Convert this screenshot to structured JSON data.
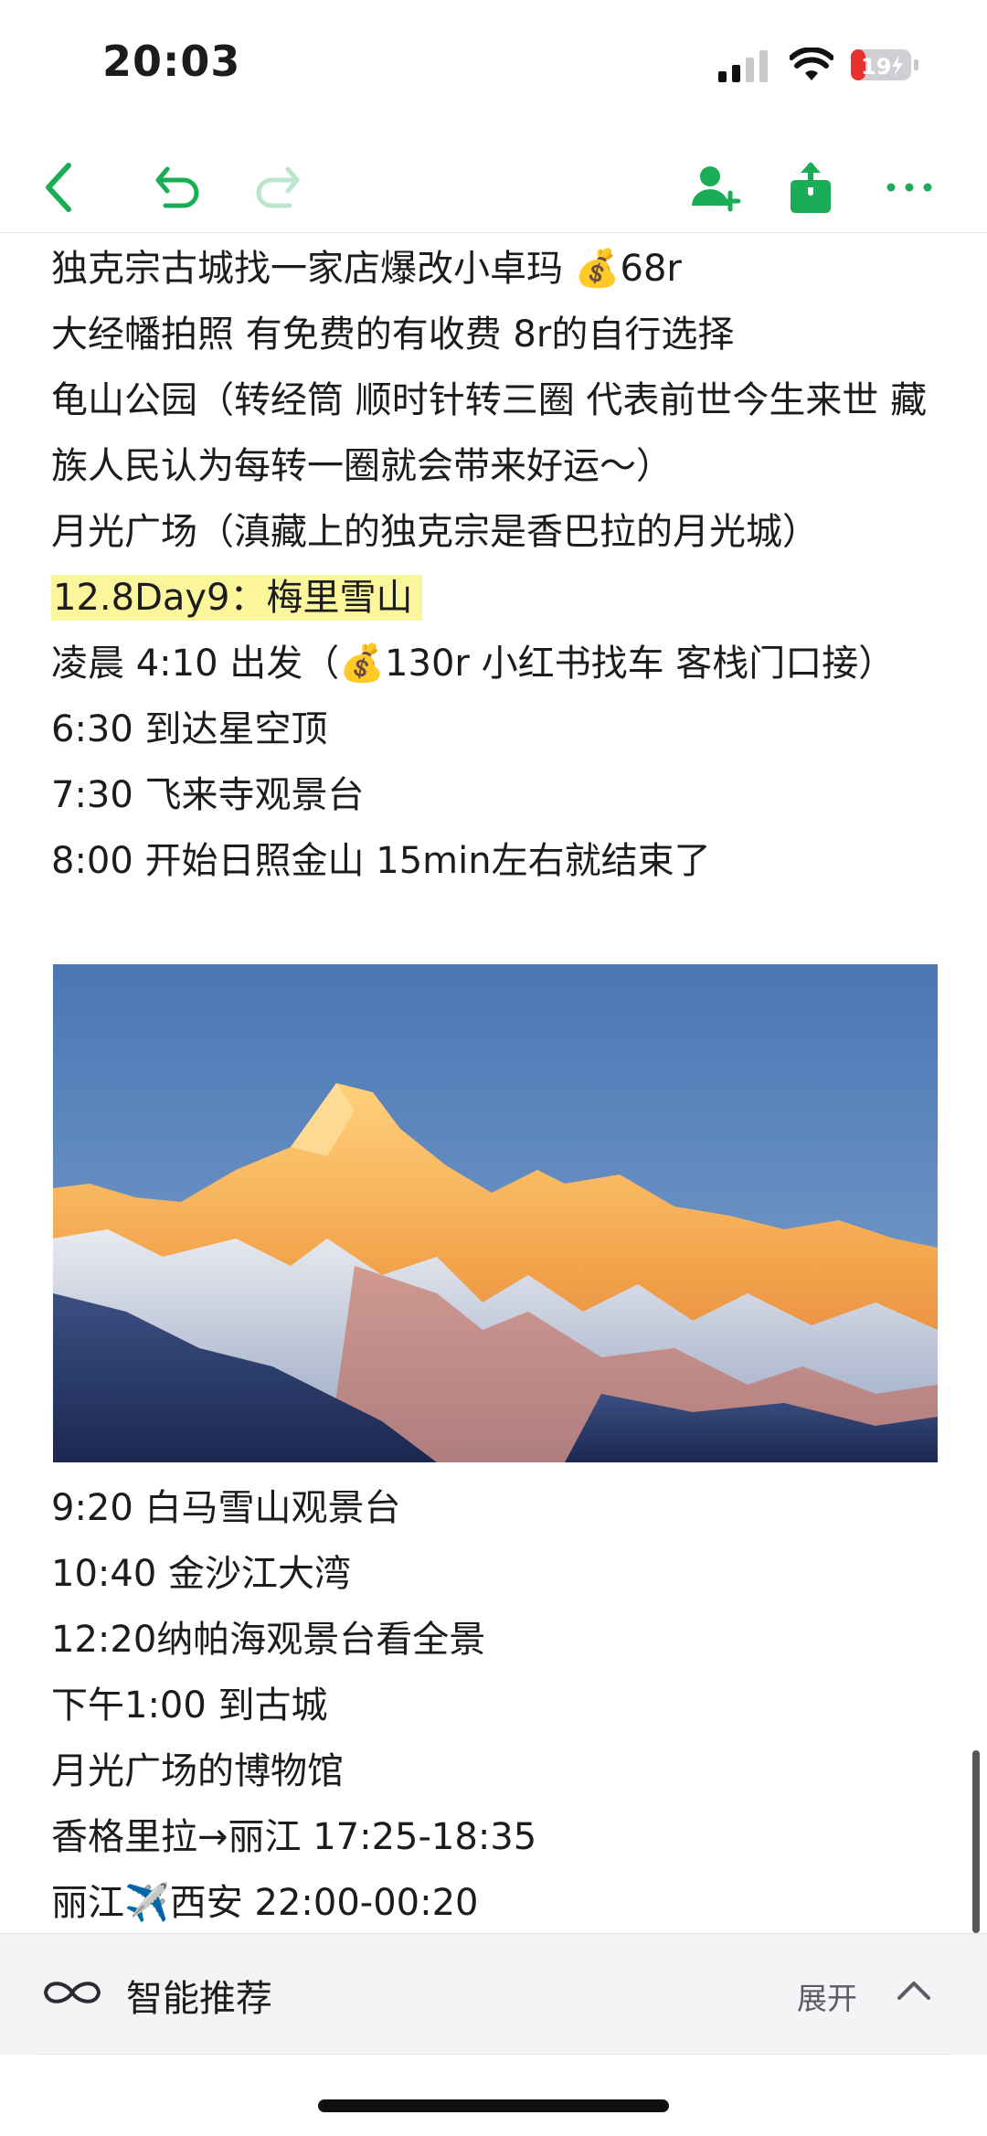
{
  "status_bar": {
    "time": "20:03",
    "battery": "19"
  },
  "toolbar": {
    "icons": [
      "back-icon",
      "undo-icon",
      "redo-icon",
      "add-collaborator-icon",
      "share-icon",
      "more-icon"
    ],
    "accent_color": "#1aad55"
  },
  "note": {
    "lines_top": [
      "独克宗古城找一家店爆改小卓玛 💰68r",
      "大经幡拍照  有免费的有收费 8r的自行选择",
      "龟山公园（转经筒 顺时针转三圈 代表前世今生来世 藏族人民认为每转一圈就会带来好运～）",
      "月光广场（滇藏上的独克宗是香巴拉的月光城）"
    ],
    "day_heading": "12.8Day9：梅里雪山",
    "lines_mid": [
      "凌晨 4:10 出发（💰130r 小红书找车  客栈门口接）",
      "6:30 到达星空顶",
      "7:30 飞来寺观景台",
      "8:00 开始日照金山 15min左右就结束了"
    ],
    "lines_bottom": [
      "9:20 白马雪山观景台",
      "10:40 金沙江大湾",
      "12:20纳帕海观景台看全景",
      "下午1:00 到古城",
      "月光广场的博物馆",
      "香格里拉→丽江 17:25-18:35",
      "丽江✈️西安 22:00-00:20"
    ]
  },
  "recommend_bar": {
    "title": "智能推荐",
    "expand_label": "展开"
  }
}
